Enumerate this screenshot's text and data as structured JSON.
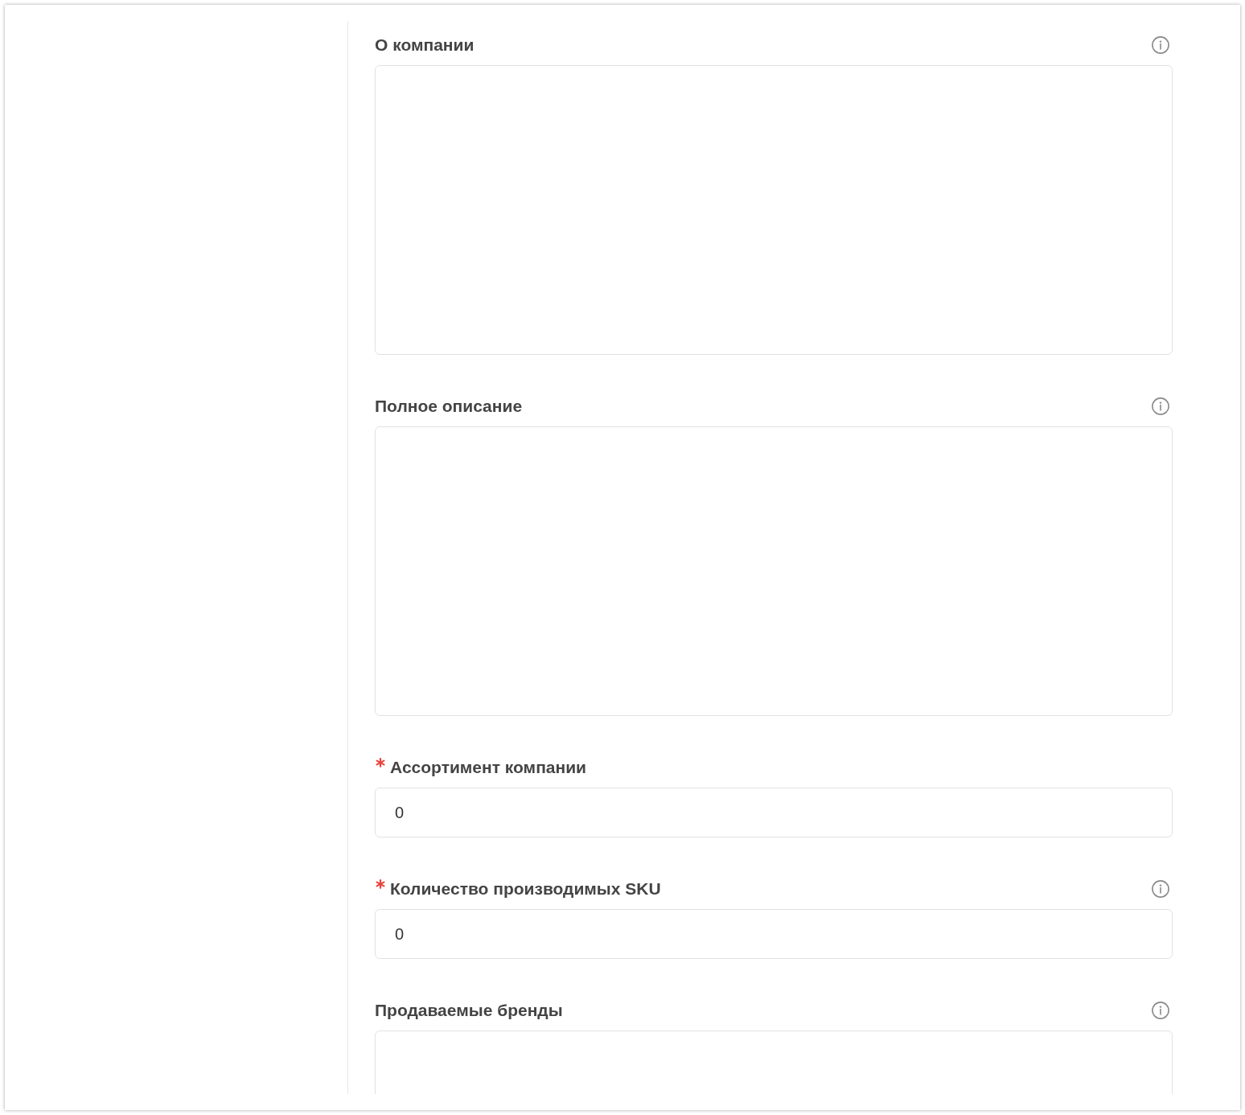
{
  "fields": [
    {
      "label": "О компании",
      "required": false,
      "info_icon": true,
      "kind": "textarea"
    },
    {
      "label": "Полное описание",
      "required": false,
      "info_icon": true,
      "kind": "textarea"
    },
    {
      "label": "Ассортимент компании",
      "required": true,
      "info_icon": false,
      "kind": "input",
      "value": "0"
    },
    {
      "label": "Количество производимых SKU",
      "required": true,
      "info_icon": true,
      "kind": "input",
      "value": "0"
    },
    {
      "label": "Продаваемые бренды",
      "required": false,
      "info_icon": true,
      "kind": "textarea"
    }
  ]
}
